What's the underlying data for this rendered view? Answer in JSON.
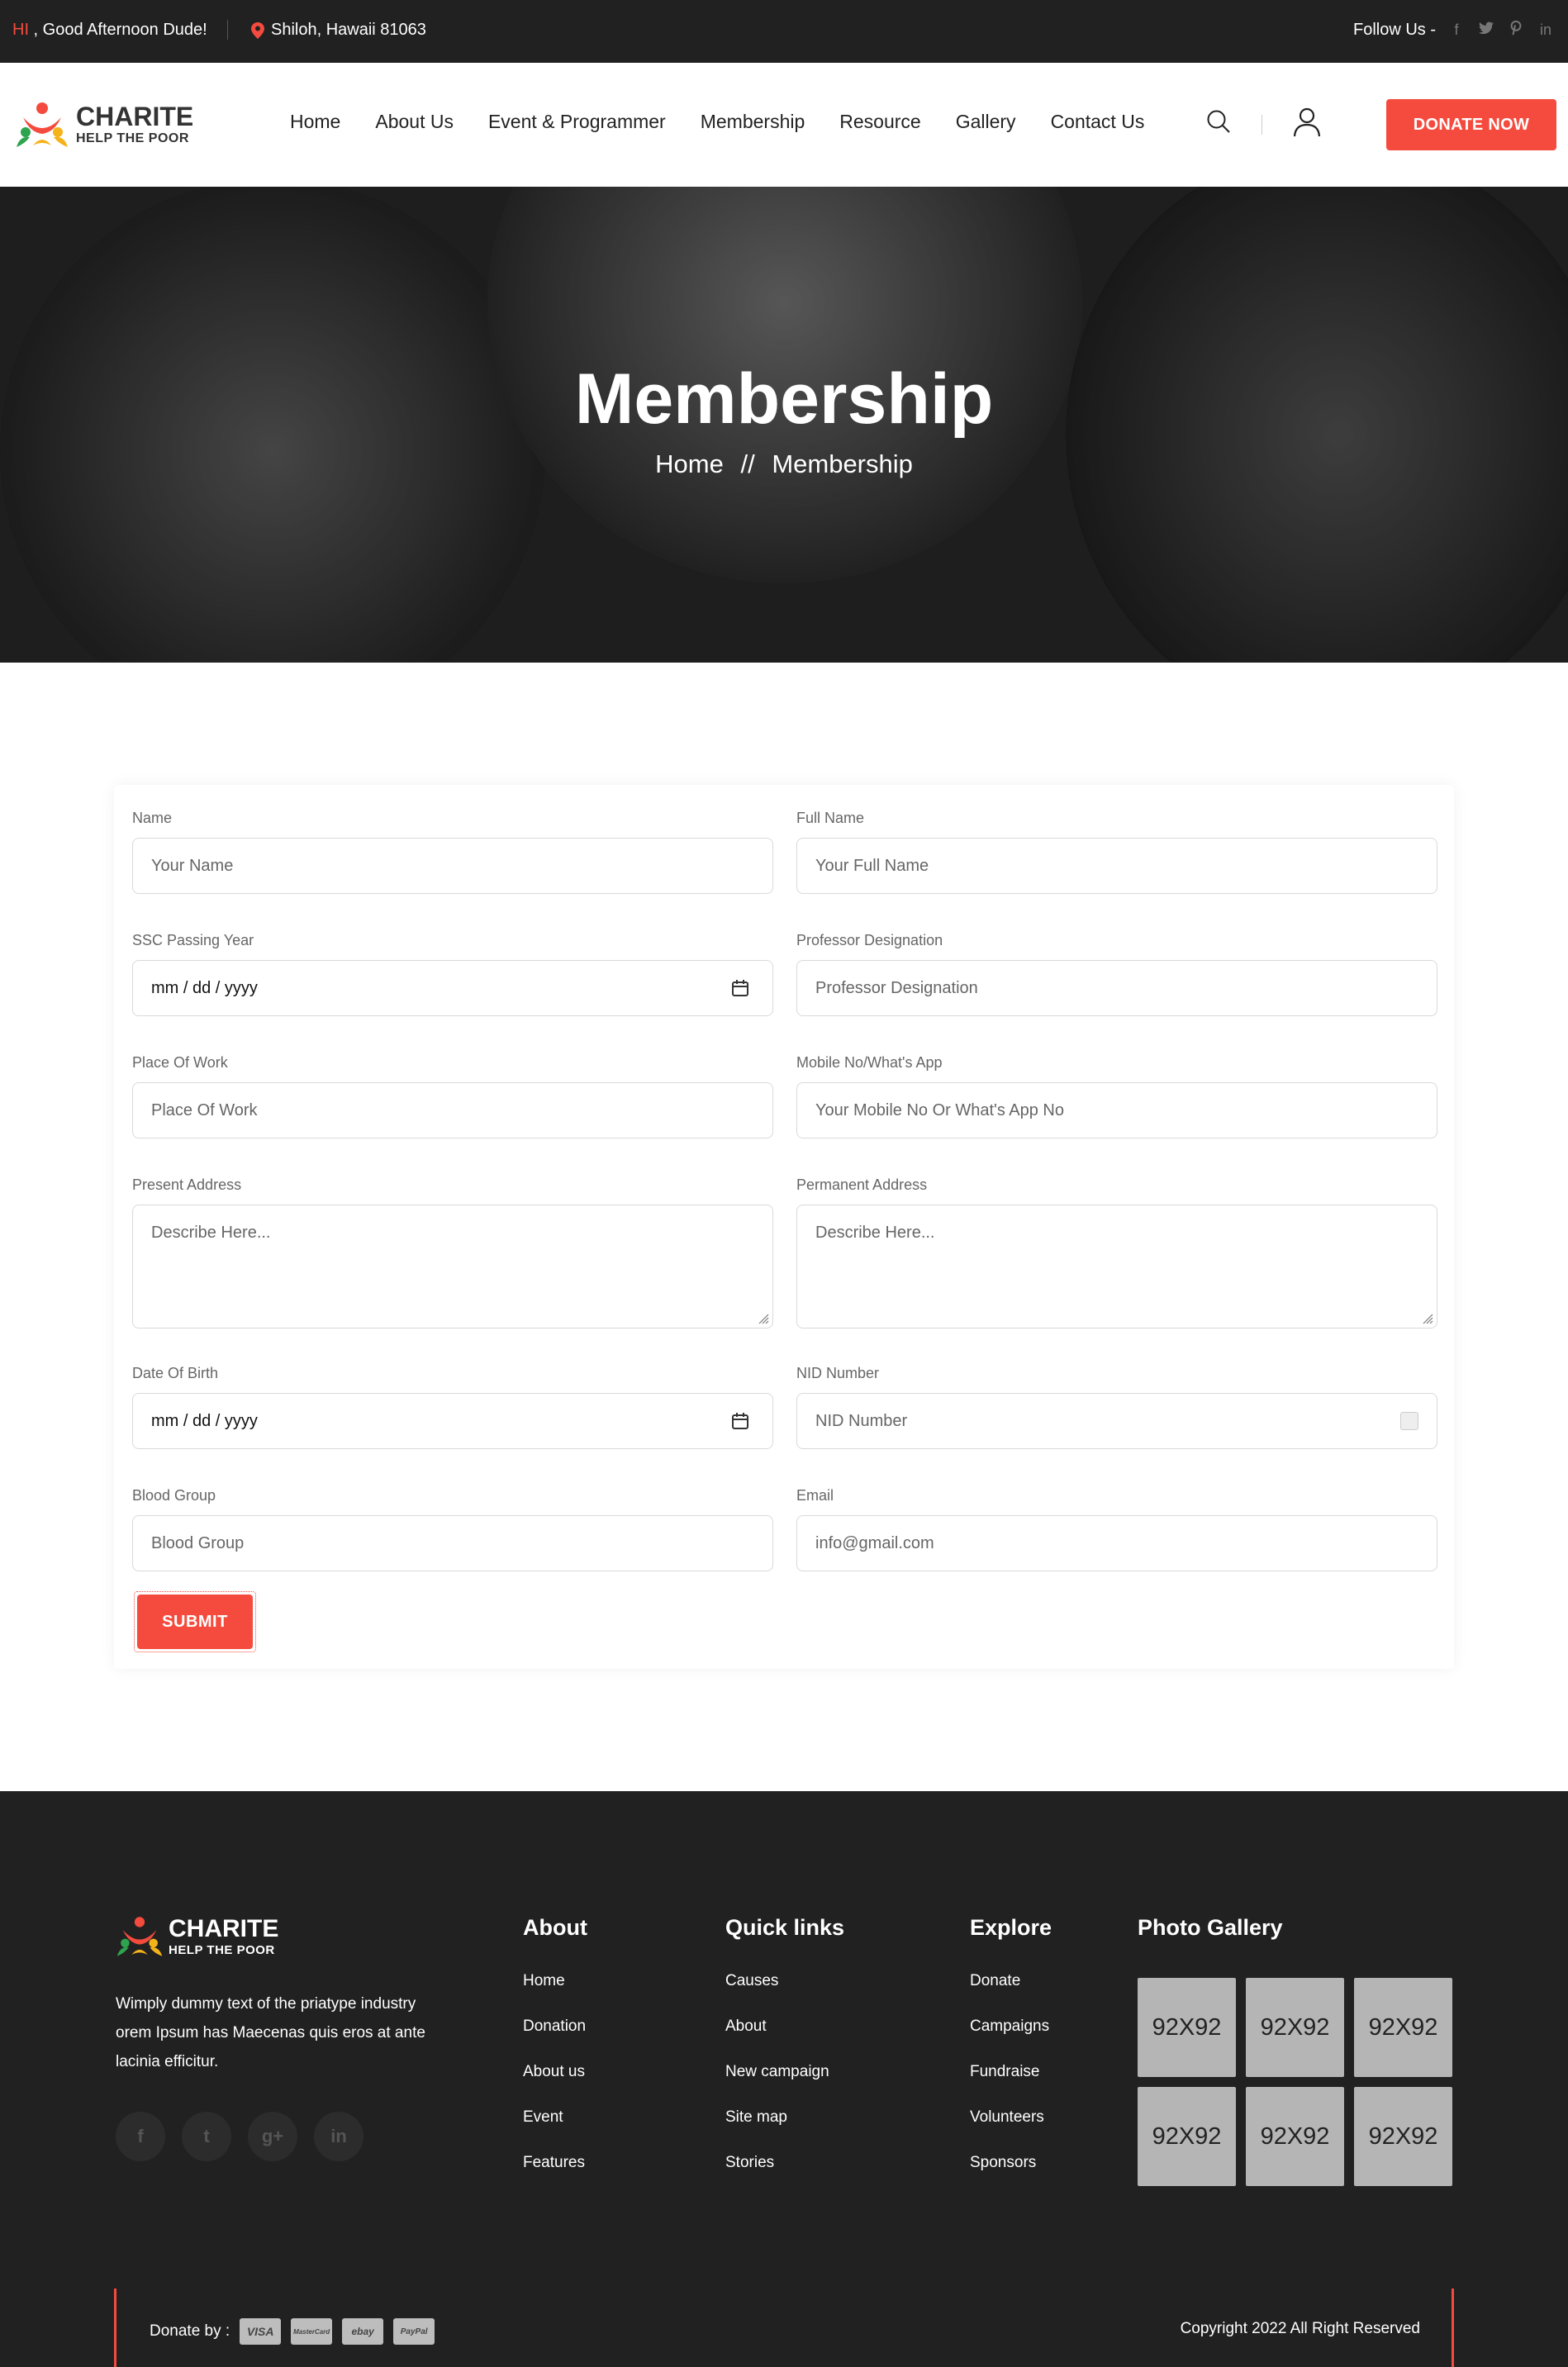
{
  "topbar": {
    "greeting_hi": "HI",
    "greeting_rest": " , Good Afternoon Dude!",
    "location": "Shiloh, Hawaii 81063",
    "follow_label": "Follow Us -",
    "socials": [
      "facebook-icon",
      "twitter-icon",
      "pinterest-icon",
      "linkedin-icon"
    ]
  },
  "header": {
    "brand": "CHARITE",
    "tagline": "HELP THE POOR",
    "nav": [
      "Home",
      "About Us",
      "Event & Programmer",
      "Membership",
      "Resource",
      "Gallery",
      "Contact Us"
    ],
    "donate_label": "DONATE NOW"
  },
  "banner": {
    "title": "Membership",
    "crumb_home": "Home",
    "crumb_sep": "//",
    "crumb_current": "Membership"
  },
  "form": {
    "fields": [
      {
        "label": "Name",
        "placeholder": "Your Name"
      },
      {
        "label": "Full Name",
        "placeholder": "Your Full Name"
      },
      {
        "label": "SSC Passing Year",
        "value": "mm / dd / yyyy"
      },
      {
        "label": "Professor Designation",
        "placeholder": "Professor Designation"
      },
      {
        "label": "Place Of Work",
        "placeholder": "Place Of Work"
      },
      {
        "label": "Mobile No/What's App",
        "placeholder": "Your Mobile No Or What's App No"
      },
      {
        "label": "Present Address",
        "placeholder": "Describe Here..."
      },
      {
        "label": "Permanent Address",
        "placeholder": "Describe Here..."
      },
      {
        "label": "Date Of Birth",
        "value": "mm / dd / yyyy"
      },
      {
        "label": "NID Number",
        "placeholder": "NID Number"
      },
      {
        "label": "Blood Group",
        "placeholder": "Blood Group"
      },
      {
        "label": "Email",
        "placeholder": "info@gmail.com"
      }
    ],
    "submit_label": "SUBMIT"
  },
  "footer": {
    "brand": "CHARITE",
    "tagline": "HELP THE POOR",
    "about_text": "Wimply dummy text of the priatype industry orem Ipsum has Maecenas quis eros at ante lacinia efficitur.",
    "social_glyphs": [
      "f",
      "t",
      "g+",
      "in"
    ],
    "columns": [
      {
        "title": "About",
        "links": [
          "Home",
          "Donation",
          "About us",
          "Event",
          "Features"
        ]
      },
      {
        "title": "Quick links",
        "links": [
          "Causes",
          "About",
          "New campaign",
          "Site map",
          "Stories"
        ]
      },
      {
        "title": "Explore",
        "links": [
          "Donate",
          "Campaigns",
          "Fundraise",
          "Volunteers",
          "Sponsors"
        ]
      }
    ],
    "gallery_title": "Photo Gallery",
    "gallery_items": [
      "92X92",
      "92X92",
      "92X92",
      "92X92",
      "92X92",
      "92X92"
    ],
    "donate_by": "Donate by :",
    "payment_methods": [
      "VISA",
      "MasterCard",
      "ebay",
      "PayPal"
    ],
    "copyright": "Copyright 2022 All Right Reserved"
  },
  "colors": {
    "accent": "#f44b3e",
    "dark": "#212121"
  }
}
